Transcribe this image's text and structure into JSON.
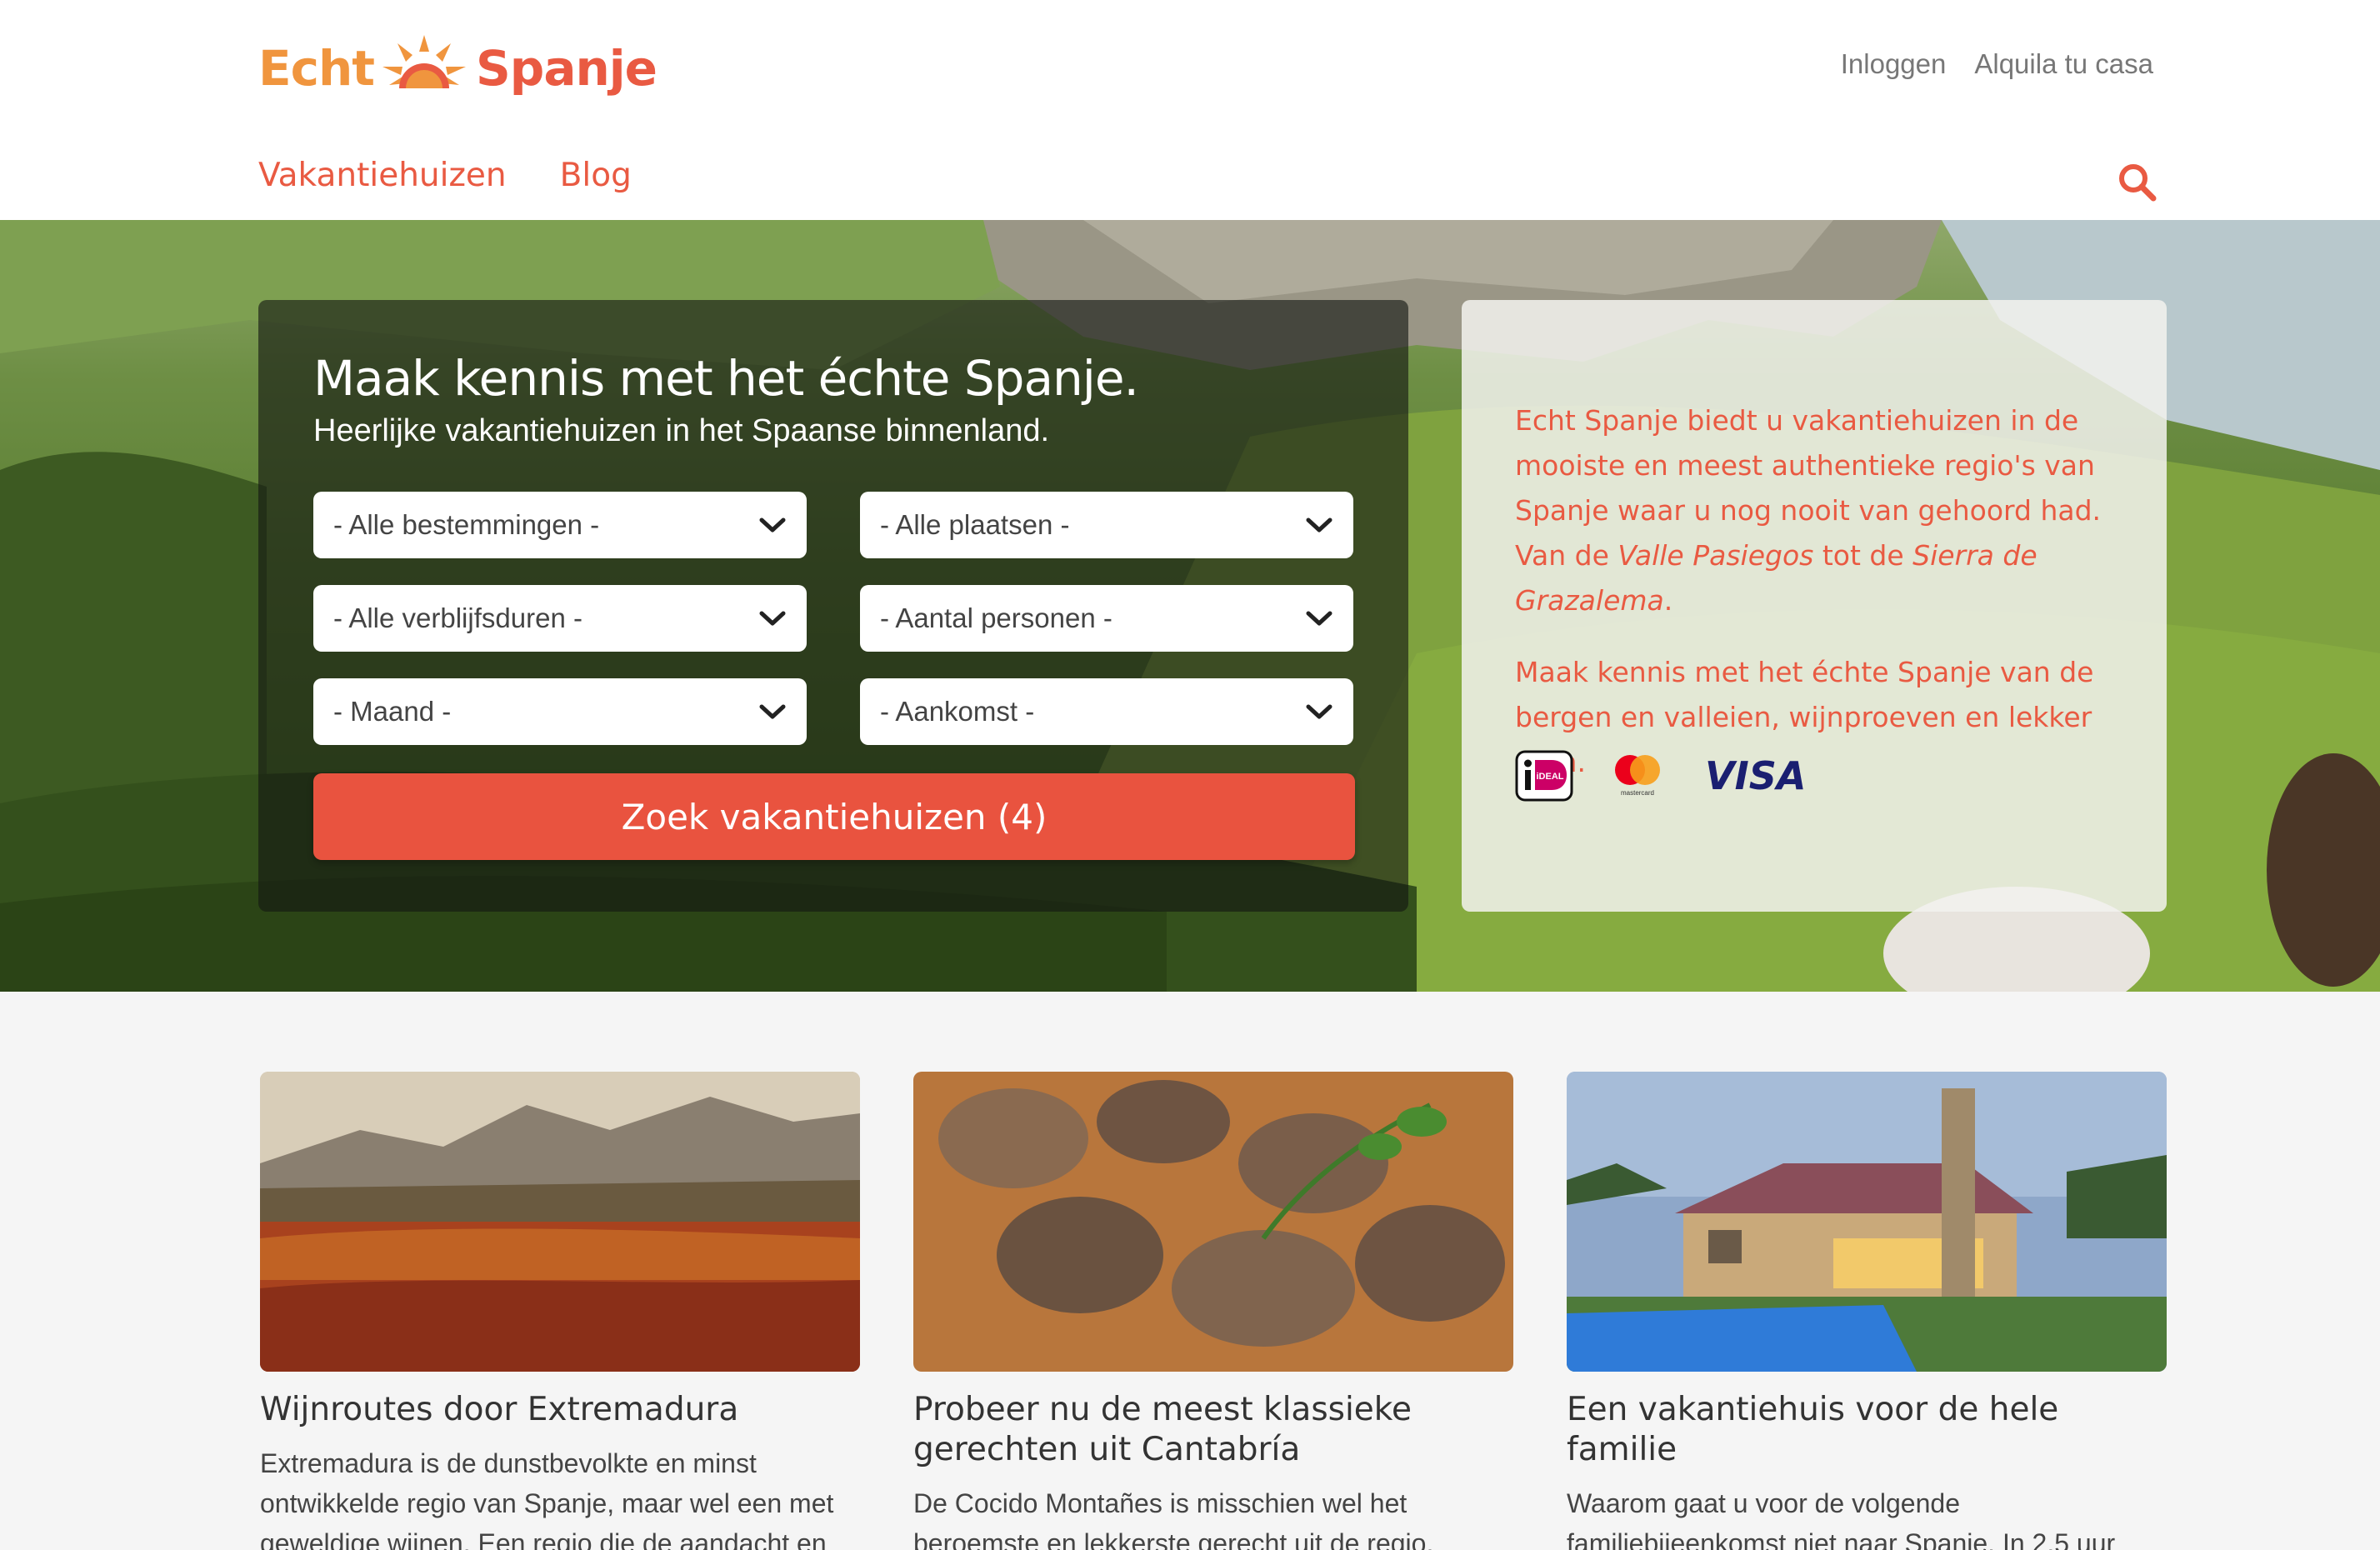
{
  "brand": {
    "word1": "Echt",
    "word2": "Spanje"
  },
  "top_links": [
    "Inloggen",
    "Alquila tu casa"
  ],
  "nav": [
    "Vakantiehuizen",
    "Blog"
  ],
  "hero": {
    "title": "Maak kennis met het échte Spanje.",
    "subtitle": "Heerlijke vakantiehuizen in het Spaanse binnenland.",
    "selects": {
      "destination": "- Alle bestemmingen -",
      "places": "- Alle plaatsen -",
      "duration": "- Alle verblijfsduren -",
      "persons": "- Aantal personen -",
      "month": "- Maand -",
      "arrival": "- Aankomst -"
    },
    "search_button": "Zoek vakantiehuizen (4)"
  },
  "info": {
    "p1_a": "Echt Spanje biedt u vakantiehuizen in de mooiste en meest authentieke regio's van Spanje waar u nog nooit van gehoord had. Van de ",
    "p1_em1": "Valle Pasiegos",
    "p1_b": " tot de ",
    "p1_em2": "Sierra de Grazalema",
    "p1_c": ".",
    "p2": "Maak kennis met het échte Spanje van de bergen en valleien, wijnproeven en lekker eten.",
    "payment": {
      "ideal": "iDEAL",
      "mastercard": "mastercard",
      "visa": "VISA"
    }
  },
  "cards": [
    {
      "title": "Wijnroutes door Extremadura",
      "text": "Extremadura is de dunstbevolkte en minst ontwikkelde regio van Spanje, maar wel een met geweldige wijnen. Een regio die de aandacht en"
    },
    {
      "title": "Probeer nu de meest klassieke gerechten uit Cantabría",
      "text": "De Cocido Montañes is misschien wel het beroemste en lekkerste gerecht uit de regio, waarbij"
    },
    {
      "title": "Een vakantiehuis voor de hele familie",
      "text": "Waarom gaat u voor de volgende familiebijeenkomst niet naar Spanje. In 2.5 uur bent u in Madrid, en een uur later bent u op het"
    }
  ],
  "colors": {
    "accent": "#e95a42",
    "orange": "#f0953e"
  }
}
